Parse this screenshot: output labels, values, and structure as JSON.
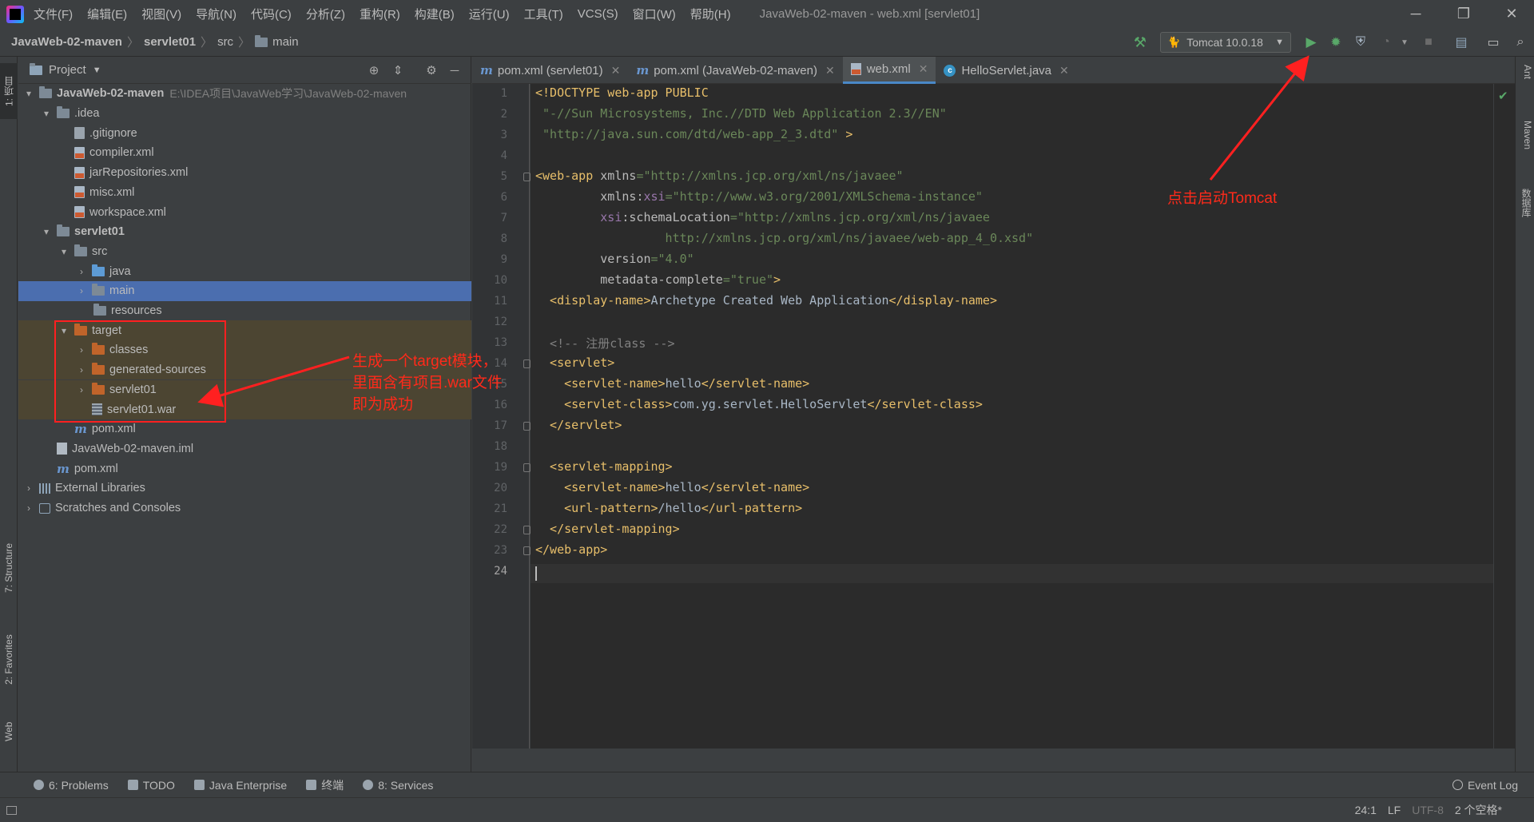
{
  "menubar": {
    "items": [
      "文件(F)",
      "编辑(E)",
      "视图(V)",
      "导航(N)",
      "代码(C)",
      "分析(Z)",
      "重构(R)",
      "构建(B)",
      "运行(U)",
      "工具(T)",
      "VCS(S)",
      "窗口(W)",
      "帮助(H)"
    ],
    "window_title": "JavaWeb-02-maven - web.xml [servlet01]"
  },
  "breadcrumb": {
    "project": "JavaWeb-02-maven",
    "module": "servlet01",
    "src": "src",
    "main": "main"
  },
  "toolbar": {
    "run_config": "Tomcat 10.0.18"
  },
  "project_panel": {
    "title": "Project",
    "tree": [
      {
        "label": "JavaWeb-02-maven",
        "hint": "E:\\IDEA项目\\JavaWeb学习\\JavaWeb-02-maven"
      },
      {
        "label": ".idea"
      },
      {
        "label": ".gitignore"
      },
      {
        "label": "compiler.xml"
      },
      {
        "label": "jarRepositories.xml"
      },
      {
        "label": "misc.xml"
      },
      {
        "label": "workspace.xml"
      },
      {
        "label": "servlet01"
      },
      {
        "label": "src"
      },
      {
        "label": "java"
      },
      {
        "label": "main"
      },
      {
        "label": "resources"
      },
      {
        "label": "target"
      },
      {
        "label": "classes"
      },
      {
        "label": "generated-sources"
      },
      {
        "label": "servlet01"
      },
      {
        "label": "servlet01.war"
      },
      {
        "label": "pom.xml"
      },
      {
        "label": "JavaWeb-02-maven.iml"
      },
      {
        "label": "pom.xml"
      },
      {
        "label": "External Libraries"
      },
      {
        "label": "Scratches and Consoles"
      }
    ]
  },
  "editor": {
    "tabs": [
      {
        "label": "pom.xml (servlet01)"
      },
      {
        "label": "pom.xml (JavaWeb-02-maven)"
      },
      {
        "label": "web.xml"
      },
      {
        "label": "HelloServlet.java"
      }
    ],
    "line_numbers": [
      "1",
      "2",
      "3",
      "4",
      "5",
      "6",
      "7",
      "8",
      "9",
      "10",
      "11",
      "12",
      "13",
      "14",
      "15",
      "16",
      "17",
      "18",
      "19",
      "20",
      "21",
      "22",
      "23",
      "24"
    ]
  },
  "left_strip": {
    "project_tab": "1: 项目",
    "structure_tab": "7: Structure",
    "favorites_tab": "2: Favorites",
    "web_tab": "Web"
  },
  "right_strip": {
    "ant_tab": "Ant",
    "maven_tab": "Maven",
    "database_tab": "数据库"
  },
  "bottom_tabs": {
    "problems": "6: Problems",
    "todo": "TODO",
    "java_enterprise": "Java Enterprise",
    "terminal": "终端",
    "services": "8: Services",
    "event_log": "Event Log"
  },
  "status_bar": {
    "position": "24:1",
    "line_sep": "LF",
    "encoding": "UTF-8",
    "indent": "2 个空格*"
  },
  "annotations": {
    "target_note_line1": "生成一个target模块，",
    "target_note_line2": "里面含有项目.war文件",
    "target_note_line3": "即为成功",
    "tomcat_note": "点击启动Tomcat"
  },
  "colors": {
    "annotation_red": "#ff2a1a",
    "selection_blue": "#4b6eaf",
    "run_green": "#59a869"
  }
}
